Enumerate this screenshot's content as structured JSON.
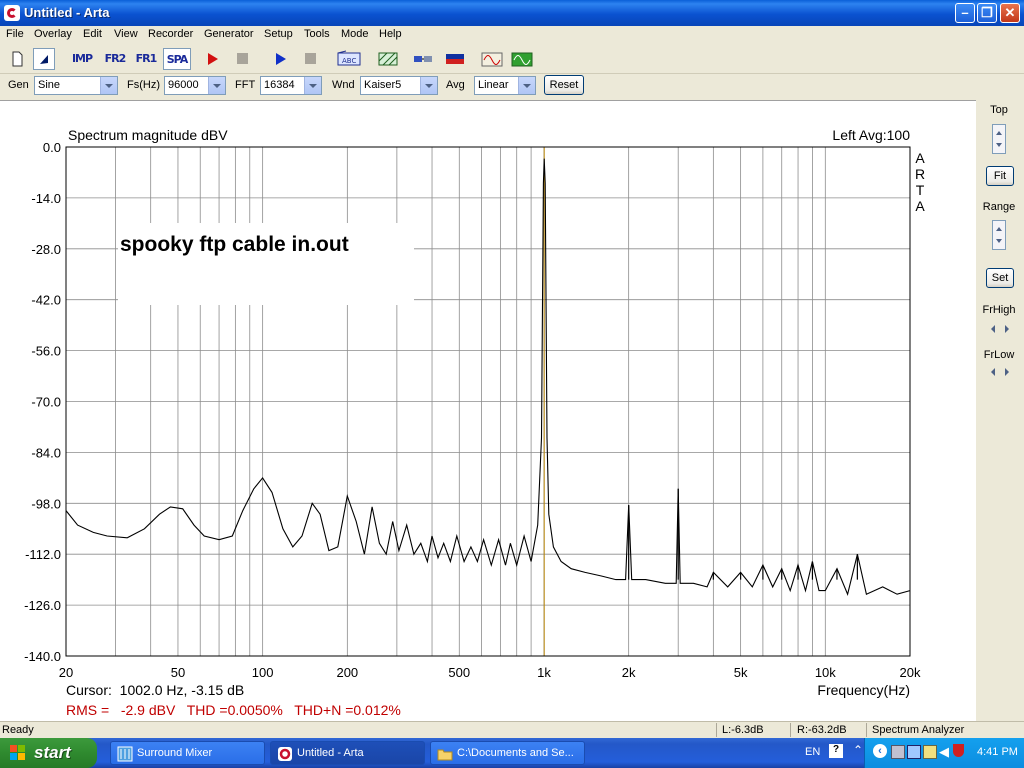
{
  "window": {
    "title": "Untitled - Arta"
  },
  "menu": [
    "File",
    "Overlay",
    "Edit",
    "View",
    "Recorder",
    "Generator",
    "Setup",
    "Tools",
    "Mode",
    "Help"
  ],
  "toolbar": {
    "imp": "IMP",
    "fr2": "FR2",
    "fr1": "FR1",
    "spa": "SPA"
  },
  "settings": {
    "gen_label": "Gen",
    "gen_value": "Sine",
    "fs_label": "Fs(Hz)",
    "fs_value": "96000",
    "fft_label": "FFT",
    "fft_value": "16384",
    "wnd_label": "Wnd",
    "wnd_value": "Kaiser5",
    "avg_label": "Avg",
    "avg_value": "Linear",
    "reset_label": "Reset"
  },
  "right_panel": {
    "top": "Top",
    "fit": "Fit",
    "range": "Range",
    "set": "Set",
    "frhigh": "FrHigh",
    "frlow": "FrLow"
  },
  "chart_data": {
    "type": "line",
    "title": "Spectrum magnitude dBV",
    "channel_info": "Left  Avg:100",
    "side_label": "ARTA",
    "annotation": "spooky ftp cable in.out",
    "xlabel": "Frequency(Hz)",
    "x_scale": "log",
    "xlim": [
      20,
      20000
    ],
    "ylim": [
      -140,
      0
    ],
    "x_ticks": [
      20,
      50,
      100,
      200,
      500,
      1000,
      2000,
      5000,
      10000,
      20000
    ],
    "x_tick_labels": [
      "20",
      "50",
      "100",
      "200",
      "500",
      "1k",
      "2k",
      "5k",
      "10k",
      "20k"
    ],
    "y_ticks": [
      0,
      -14,
      -28,
      -42,
      -56,
      -70,
      -84,
      -98,
      -112,
      -126,
      -140
    ],
    "y_tick_labels": [
      "0.0",
      "-14.0",
      "-28.0",
      "-42.0",
      "-56.0",
      "-70.0",
      "-84.0",
      "-98.0",
      "-112.0",
      "-126.0",
      "-140.0"
    ],
    "grid": true,
    "cursor_freq": 1002,
    "cursor_text": "Cursor:  1002.0 Hz, -3.15 dB",
    "stats_text": "RMS =   -2.9 dBV   THD =0.0050%   THD+N =0.012%",
    "series": [
      {
        "points": [
          [
            20,
            -100
          ],
          [
            22,
            -104
          ],
          [
            25,
            -106
          ],
          [
            28,
            -107
          ],
          [
            33,
            -107.5
          ],
          [
            38,
            -105
          ],
          [
            43,
            -101
          ],
          [
            47,
            -99
          ],
          [
            52,
            -99.5
          ],
          [
            57,
            -104
          ],
          [
            62,
            -107
          ],
          [
            70,
            -108
          ],
          [
            78,
            -107
          ],
          [
            85,
            -100
          ],
          [
            93,
            -94
          ],
          [
            100,
            -91
          ],
          [
            108,
            -95
          ],
          [
            118,
            -105
          ],
          [
            128,
            -110
          ],
          [
            138,
            -107
          ],
          [
            150,
            -98
          ],
          [
            160,
            -101
          ],
          [
            172,
            -111
          ],
          [
            185,
            -110
          ],
          [
            200,
            -96
          ],
          [
            215,
            -103
          ],
          [
            230,
            -112
          ],
          [
            245,
            -99
          ],
          [
            260,
            -109
          ],
          [
            275,
            -112
          ],
          [
            290,
            -103
          ],
          [
            305,
            -111
          ],
          [
            325,
            -104
          ],
          [
            345,
            -112
          ],
          [
            365,
            -109
          ],
          [
            385,
            -114
          ],
          [
            400,
            -107
          ],
          [
            420,
            -113
          ],
          [
            440,
            -109
          ],
          [
            465,
            -114
          ],
          [
            490,
            -107
          ],
          [
            520,
            -114
          ],
          [
            550,
            -110
          ],
          [
            580,
            -114
          ],
          [
            610,
            -108
          ],
          [
            650,
            -115
          ],
          [
            690,
            -108
          ],
          [
            730,
            -115
          ],
          [
            760,
            -109
          ],
          [
            800,
            -115
          ],
          [
            850,
            -107
          ],
          [
            900,
            -114
          ],
          [
            950,
            -104
          ],
          [
            980,
            -80
          ],
          [
            995,
            -10
          ],
          [
            1002,
            -3.2
          ],
          [
            1010,
            -10
          ],
          [
            1025,
            -80
          ],
          [
            1040,
            -101
          ],
          [
            1080,
            -110
          ],
          [
            1150,
            -114
          ],
          [
            1250,
            -116
          ],
          [
            1400,
            -117
          ],
          [
            1600,
            -118
          ],
          [
            1800,
            -119
          ],
          [
            1950,
            -119
          ],
          [
            2000,
            -98.5
          ],
          [
            2050,
            -119
          ],
          [
            2300,
            -119
          ],
          [
            2700,
            -120
          ],
          [
            2950,
            -120
          ],
          [
            3000,
            -94
          ],
          [
            3050,
            -120
          ],
          [
            3400,
            -120
          ],
          [
            3800,
            -121
          ],
          [
            4000,
            -117
          ],
          [
            4500,
            -121
          ],
          [
            5000,
            -117
          ],
          [
            5500,
            -121
          ],
          [
            6000,
            -115
          ],
          [
            6500,
            -121
          ],
          [
            7000,
            -116
          ],
          [
            7500,
            -122
          ],
          [
            8000,
            -115
          ],
          [
            8500,
            -122
          ],
          [
            9000,
            -114
          ],
          [
            9500,
            -122
          ],
          [
            10000,
            -122
          ],
          [
            11000,
            -116
          ],
          [
            12000,
            -123
          ],
          [
            13000,
            -112
          ],
          [
            14000,
            -123
          ],
          [
            16000,
            -121
          ],
          [
            18000,
            -123
          ],
          [
            20000,
            -122
          ]
        ],
        "harmonics": [
          [
            2000,
            -98.5
          ],
          [
            3000,
            -94
          ],
          [
            4000,
            -117
          ],
          [
            5000,
            -117
          ],
          [
            6000,
            -115
          ],
          [
            7000,
            -116
          ],
          [
            8000,
            -115
          ],
          [
            9000,
            -114
          ],
          [
            11000,
            -116
          ],
          [
            13000,
            -112
          ]
        ]
      }
    ]
  },
  "statusbar": {
    "ready": "Ready",
    "left": "L:-6.3dB",
    "right": "R:-63.2dB",
    "mode": "Spectrum Analyzer"
  },
  "taskbar": {
    "start": "start",
    "tasks": [
      "Surround Mixer",
      "Untitled - Arta",
      "C:\\Documents and Se..."
    ],
    "lang": "EN",
    "time": "4:41 PM"
  },
  "colors": {
    "titlebar": "#0a52d0",
    "curve": "#000000",
    "cursor": "#b8860b",
    "stats": "#c00000",
    "annotation_bg": "#ffffff"
  }
}
